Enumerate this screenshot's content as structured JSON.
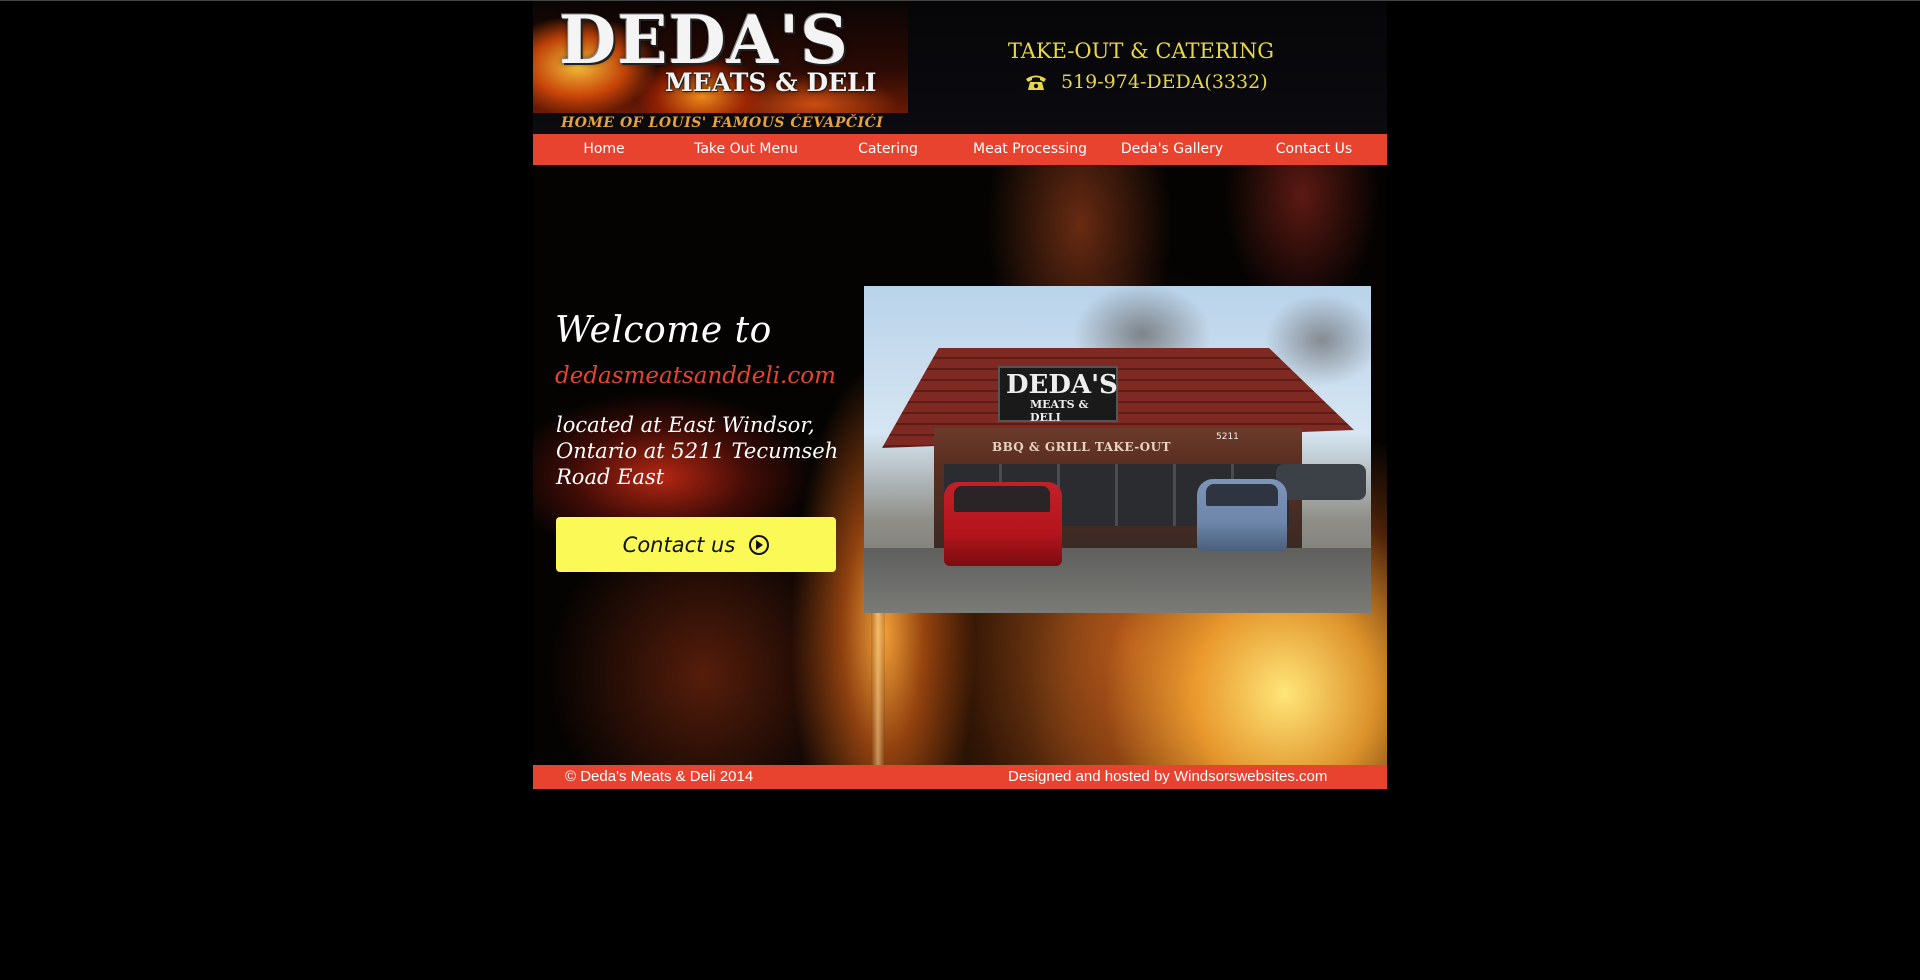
{
  "header": {
    "logo": {
      "name_big": "DEDA'S",
      "name_sub": "MEATS & DELI",
      "tagline": "HOME OF LOUIS' FAMOUS ĆEVAPČIĆI"
    },
    "takeout_catering": "TAKE-OUT & CATERING",
    "phone": "519-974-DEDA(3332)",
    "phone_icon": "telephone-icon"
  },
  "nav": {
    "items": [
      {
        "label": "Home"
      },
      {
        "label": "Take Out Menu"
      },
      {
        "label": "Catering"
      },
      {
        "label": "Meat Processing"
      },
      {
        "label": "Deda's Gallery"
      },
      {
        "label": "Contact Us"
      }
    ]
  },
  "main": {
    "welcome": "Welcome to",
    "domain": "dedasmeatsanddeli.com",
    "address": "located at East Windsor, Ontario at 5211 Tecumseh Road East",
    "contact_button": {
      "label": "Contact us",
      "icon": "arrow-right-circle-icon"
    },
    "store_photo": {
      "sign_big": "DEDA'S",
      "sign_small": "MEATS & DELI",
      "storefront_text": "BBQ & GRILL TAKE-OUT",
      "address_number": "5211"
    }
  },
  "footer": {
    "copyright": "© Deda's Meats & Deli 2014",
    "credit": "Designed and hosted by Windsorswebsites.com"
  },
  "colors": {
    "nav_bg": "#e8432f",
    "accent_red": "#e8432f",
    "header_yellow": "#e6d74a",
    "button_yellow": "#fbf955",
    "background": "#000000"
  }
}
